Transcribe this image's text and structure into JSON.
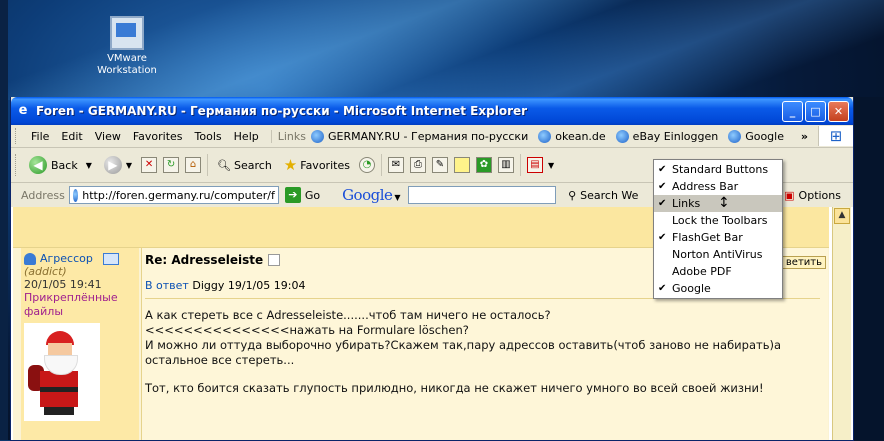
{
  "desktop": {
    "icon": {
      "label_line1": "VMware",
      "label_line2": "Workstation",
      "icon": "vmware-icon"
    }
  },
  "window": {
    "title": "Foren - GERMANY.RU - Германия по-русски - Microsoft Internet Explorer",
    "controls": {
      "minimize": "_",
      "maximize": "□",
      "close": "✕"
    }
  },
  "menubar": {
    "items": [
      "File",
      "Edit",
      "View",
      "Favorites",
      "Tools",
      "Help"
    ],
    "links_label": "Links",
    "links": [
      "GERMANY.RU - Германия по-русски",
      "okean.de",
      "eBay Einloggen",
      "Google"
    ],
    "chevron": "»"
  },
  "toolbar": {
    "back_label": "Back",
    "search_label": "Search",
    "favorites_label": "Favorites"
  },
  "addressbar": {
    "label": "Address",
    "url": "http://foren.germany.ru/computer/f",
    "go_label": "Go",
    "google_label": "Google",
    "search_web_label": "Search We",
    "options_label": "Options"
  },
  "post": {
    "author": "Агрессор",
    "role": "(addict)",
    "date": "20/1/05 19:41",
    "attachments_line1": "Прикреплённые",
    "attachments_line2": "файлы",
    "title": "Re: Adresseleiste",
    "reply_button": "ветить",
    "reply_prefix": "В ответ",
    "reply_to": "Diggy",
    "reply_date": "19/1/05 19:04",
    "body": [
      "А как стереть все с Adresseleiste.......чтоб там ничего не осталось?",
      "<<<<<<<<<<<<<<<нажать на Formulare löschen?",
      "И можно ли оттуда выборочно убирать?Скажем так,пару адрессов оставить(чтоб заново не набирать)а",
      "остальное все стереть..."
    ],
    "signature": "Тот, кто боится сказать глупость прилюдно, никогда не скажет ничего умного во всей своей жизни!"
  },
  "context_menu": {
    "items": [
      {
        "label": "Standard Buttons",
        "checked": true
      },
      {
        "label": "Address Bar",
        "checked": true
      },
      {
        "label": "Links",
        "checked": true
      },
      {
        "label": "Lock the Toolbars",
        "checked": false
      },
      {
        "label": "FlashGet Bar",
        "checked": true
      },
      {
        "label": "Norton AntiVirus",
        "checked": false
      },
      {
        "label": "Adobe PDF",
        "checked": false
      },
      {
        "label": "Google",
        "checked": true
      }
    ],
    "hovered": "Links"
  }
}
